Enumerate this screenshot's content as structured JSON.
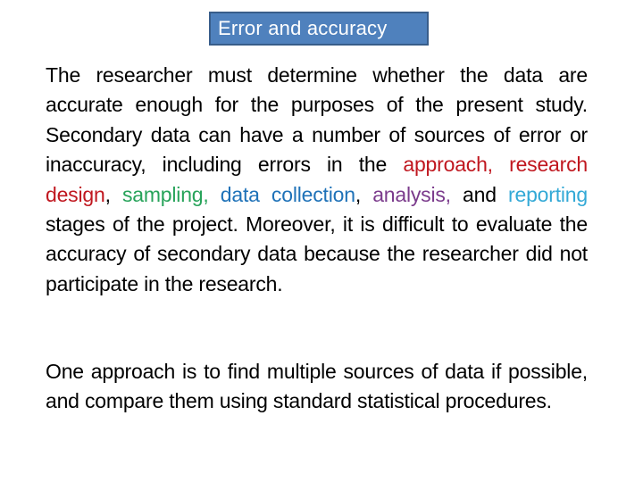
{
  "title": "Error and accuracy",
  "paragraph1": {
    "seg1": "The researcher must determine whether the data are accurate enough for the purposes of the present study. Secondary data can have a number of sources of error or inaccuracy, including errors in the ",
    "approach": "approach, research design",
    "comma1": ", ",
    "sampling": "sampling,",
    "space1": " ",
    "data_collection": "data collection",
    "comma2": ", ",
    "analysis": "analysis,",
    "and": " and ",
    "reporting": "reporting",
    "seg2": " stages of the project. Moreover, it is difficult to evaluate the accuracy of secondary data because the researcher did not participate in the research."
  },
  "paragraph2": "One approach is to find multiple sources of data if possible, and compare them using standard statistical procedures.",
  "colors": {
    "title_bg": "#4f81bd",
    "red": "#c0171f",
    "green": "#27a35a",
    "blue": "#1f72b8",
    "purple": "#7b3b8c",
    "cyan": "#33a9d6"
  }
}
